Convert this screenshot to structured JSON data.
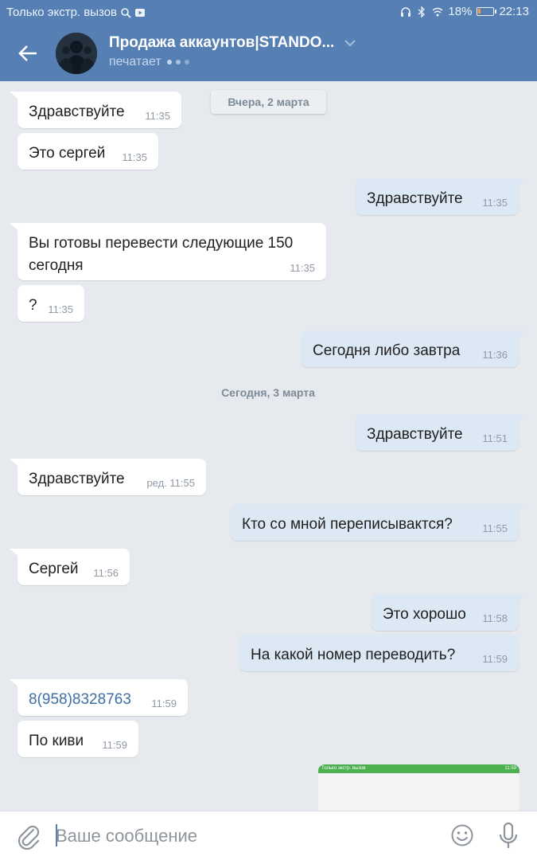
{
  "status_bar": {
    "carrier": "Только экстр. вызов",
    "battery": "18%",
    "battery_level": 0.18,
    "time": "22:13",
    "icons": [
      "search-icon",
      "video-icon",
      "headphones-icon",
      "bluetooth-icon",
      "wifi-icon",
      "battery-icon"
    ]
  },
  "header": {
    "title": "Продажа аккаунтов|STANDO...",
    "subtitle": "печатает",
    "icons": [
      "back-arrow-icon",
      "avatar",
      "chevron-down-icon",
      "typing-dots-icon"
    ]
  },
  "colors": {
    "accent": "#5680b4",
    "background": "#e6eaee",
    "incoming_bubble": "#ffffff",
    "outgoing_bubble": "#dde8f5",
    "link": "#3f6fa3"
  },
  "dates": [
    "Вчера, 2 марта",
    "Сегодня, 3 марта"
  ],
  "messages": [
    {
      "dir": "in",
      "text": "Здравствуйте",
      "time": "11:35"
    },
    {
      "dir": "in",
      "text": "Это сергей",
      "time": "11:35"
    },
    {
      "dir": "out",
      "text": "Здравствуйте",
      "time": "11:35"
    },
    {
      "dir": "in",
      "text": "Вы готовы перевести следующие 150 сегодня",
      "time": "11:35"
    },
    {
      "dir": "in",
      "text": "?",
      "time": "11:35"
    },
    {
      "dir": "out",
      "text": "Сегодня либо завтра",
      "time": "11:36"
    },
    {
      "dir": "out",
      "text": "Здравствуйте",
      "time": "11:51"
    },
    {
      "dir": "in",
      "text": "Здравствуйте",
      "time": "ред. 11:55"
    },
    {
      "dir": "out",
      "text": "Кто со мной переписывактся?",
      "time": "11:55"
    },
    {
      "dir": "in",
      "text": "Сергей",
      "time": "11:56"
    },
    {
      "dir": "out",
      "text": "Это хорошо",
      "time": "11:58"
    },
    {
      "dir": "out",
      "text": "На какой номер переводить?",
      "time": "11:59"
    },
    {
      "dir": "in",
      "text": "8(958)8328763",
      "time": "11:59"
    },
    {
      "dir": "in",
      "text": "По киви",
      "time": "11:59"
    }
  ],
  "attachment_preview": {
    "status_text": "Только экстр. вызов",
    "time": "11:59"
  },
  "input_bar": {
    "placeholder": "Ваше сообщение",
    "icons": [
      "paperclip-icon",
      "emoji-icon",
      "microphone-icon"
    ]
  }
}
